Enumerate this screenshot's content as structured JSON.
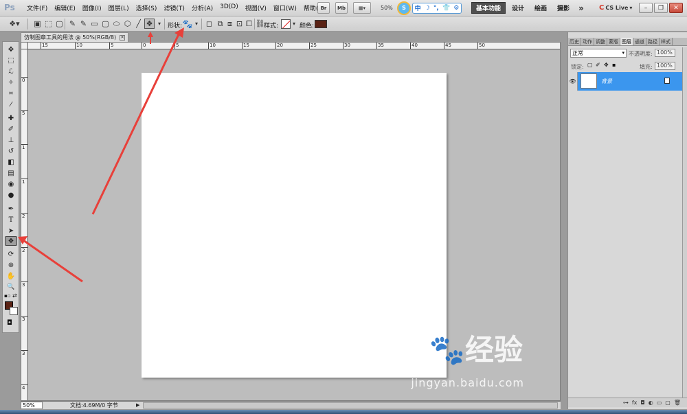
{
  "app": {
    "logo": "Ps",
    "menu": [
      "文件(F)",
      "编辑(E)",
      "图像(I)",
      "图层(L)",
      "选择(S)",
      "滤镜(T)",
      "分析(A)",
      "3D(D)",
      "视图(V)",
      "窗口(W)",
      "帮助(H)"
    ],
    "bridge_label": "Br",
    "minibridge_label": "Mb",
    "zoom": "50%",
    "ime": {
      "face": "S",
      "mode": "中",
      "glyphs": [
        "☽",
        "°,",
        "👕",
        "⚙"
      ]
    },
    "workspaces": [
      "基本功能",
      "设计",
      "绘画",
      "摄影"
    ],
    "more": "»",
    "cs_live": "CS Live",
    "cs_live_arrow": "▾",
    "window_controls": [
      "–",
      "❐",
      "✕"
    ]
  },
  "options": {
    "shape_label": "形状:",
    "shape_icon": "paw-icon",
    "shape_glyph": "🐾",
    "style_label": "样式:",
    "color_label": "颜色:",
    "color_swatch": "#5a2214",
    "dropdown_glyph": "▾",
    "tool_glyphs": [
      "✎",
      "✎",
      "▭",
      "▢",
      "⬭",
      "⬡",
      "╱",
      "❖"
    ]
  },
  "toolbox": {
    "tools": [
      {
        "name": "move-tool",
        "glyph": "✥"
      },
      {
        "name": "marquee-tool",
        "glyph": "⬚"
      },
      {
        "name": "lasso-tool",
        "glyph": "ℒ"
      },
      {
        "name": "quick-select-tool",
        "glyph": "✧"
      },
      {
        "name": "crop-tool",
        "glyph": "⌗"
      },
      {
        "name": "eyedropper-tool",
        "glyph": "⁄"
      },
      {
        "name": "healing-tool",
        "glyph": "✚"
      },
      {
        "name": "brush-tool",
        "glyph": "✐"
      },
      {
        "name": "stamp-tool",
        "glyph": "⊥"
      },
      {
        "name": "history-brush-tool",
        "glyph": "↺"
      },
      {
        "name": "eraser-tool",
        "glyph": "◧"
      },
      {
        "name": "gradient-tool",
        "glyph": "▤"
      },
      {
        "name": "blur-tool",
        "glyph": "◉"
      },
      {
        "name": "dodge-tool",
        "glyph": "●"
      },
      {
        "name": "pen-tool",
        "glyph": "✒"
      },
      {
        "name": "type-tool",
        "glyph": "T"
      },
      {
        "name": "path-select-tool",
        "glyph": "➤"
      },
      {
        "name": "custom-shape-tool",
        "glyph": "❖"
      },
      {
        "name": "3d-rotate-tool",
        "glyph": "⟳"
      },
      {
        "name": "3d-orbit-tool",
        "glyph": "⊛"
      },
      {
        "name": "hand-tool",
        "glyph": "✋"
      },
      {
        "name": "zoom-tool",
        "glyph": "🔍"
      }
    ],
    "active_tool": "custom-shape-tool",
    "foreground": "#5a2214",
    "background": "#ffffff",
    "quickmask_glyph": "◘"
  },
  "document": {
    "tab_title": "仿制图章工具的用法 @ 50%(RGB/8)",
    "tab_close": "✕",
    "ruler_h": [
      "15",
      "10",
      "5",
      "0",
      "5",
      "10",
      "15",
      "20",
      "25",
      "30",
      "35",
      "40",
      "45",
      "50"
    ],
    "ruler_v": [
      "0",
      "5",
      "1",
      "1",
      "2",
      "2",
      "3",
      "3",
      "3",
      "4"
    ],
    "status_zoom": "50%",
    "status_doc": "文档:4.69M/0 字节",
    "status_arrow": "▶",
    "watermark_main": "Bai🐾经验",
    "watermark_sub": "jingyan.baidu.com"
  },
  "layers_panel": {
    "tabs": [
      "历史",
      "动作",
      "调整",
      "蒙版",
      "图层",
      "通道",
      "路径",
      "样式"
    ],
    "active_tab": "图层",
    "blend_mode": "正常",
    "opacity_label": "不透明度:",
    "opacity_value": "100%",
    "lock_label": "锁定:",
    "fill_label": "填充:",
    "fill_value": "100%",
    "layers": [
      {
        "name": "背景",
        "visible_glyph": "👁"
      }
    ],
    "bottom_icons": [
      "⊶",
      "fx",
      "◘",
      "◐",
      "▭",
      "▢",
      "🗑"
    ]
  },
  "colors": {
    "accent": "#3b96ee",
    "annotation_arrow": "#e8403a"
  }
}
